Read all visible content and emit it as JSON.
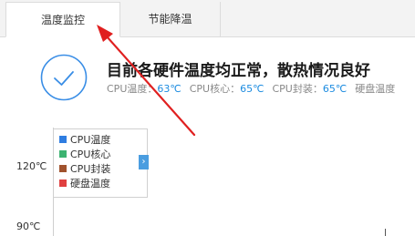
{
  "tabs": [
    {
      "label": "温度监控",
      "active": true
    },
    {
      "label": "节能降温",
      "active": false
    }
  ],
  "status": {
    "icon": "check-circle-icon",
    "headline": "目前各硬件温度均正常，散热情况良好",
    "metrics": [
      {
        "label": "CPU温度：",
        "value": "63℃"
      },
      {
        "label": "CPU核心：",
        "value": "65℃"
      },
      {
        "label": "CPU封装：",
        "value": "65℃"
      },
      {
        "label": "硬盘温度",
        "value": ""
      }
    ]
  },
  "chart": {
    "y_ticks": [
      "120℃",
      "90℃"
    ],
    "legend": [
      {
        "label": "CPU温度",
        "color": "#2f7de1"
      },
      {
        "label": "CPU核心",
        "color": "#3cb371"
      },
      {
        "label": "CPU封装",
        "color": "#a0522d"
      },
      {
        "label": "硬盘温度",
        "color": "#e04040"
      }
    ],
    "legend_toggle": "›"
  },
  "colors": {
    "accent": "#1d8ce0",
    "annotation_arrow": "#e02020"
  }
}
